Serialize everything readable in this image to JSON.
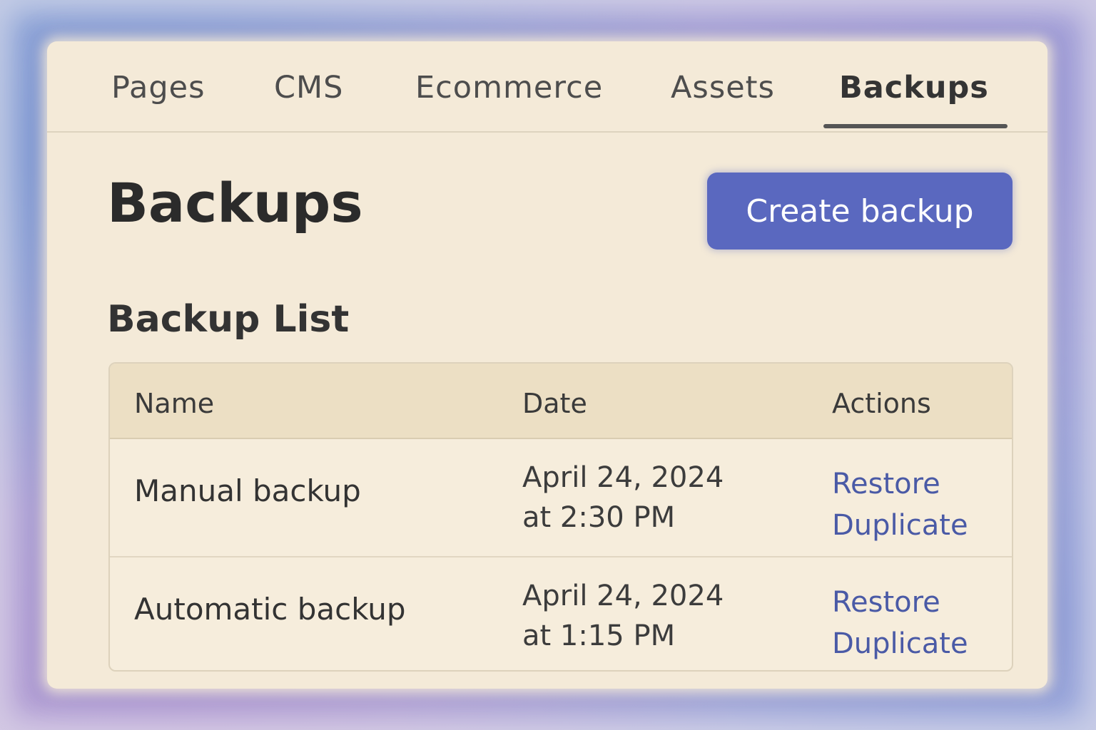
{
  "nav": {
    "tabs": [
      {
        "label": "Pages"
      },
      {
        "label": "CMS"
      },
      {
        "label": "Ecommerce"
      },
      {
        "label": "Assets"
      },
      {
        "label": "Backups",
        "active": true
      }
    ]
  },
  "header": {
    "title": "Backups",
    "create_button_label": "Create backup"
  },
  "colors": {
    "accent": "#5a68bf",
    "link": "#4a5aa6",
    "panel_background": "#f4ead8"
  },
  "backup_list": {
    "title": "Backup List",
    "columns": [
      "Name",
      "Date",
      "Actions"
    ],
    "rows": [
      {
        "name": "Manual backup",
        "date_line1": "April 24, 2024",
        "date_line2": "at 2:30 PM",
        "actions": [
          "Restore",
          "Duplicate"
        ]
      },
      {
        "name": "Automatic backup",
        "date_line1": "April 24, 2024",
        "date_line2": "at 1:15 PM",
        "actions": [
          "Restore",
          "Duplicate"
        ]
      }
    ]
  }
}
